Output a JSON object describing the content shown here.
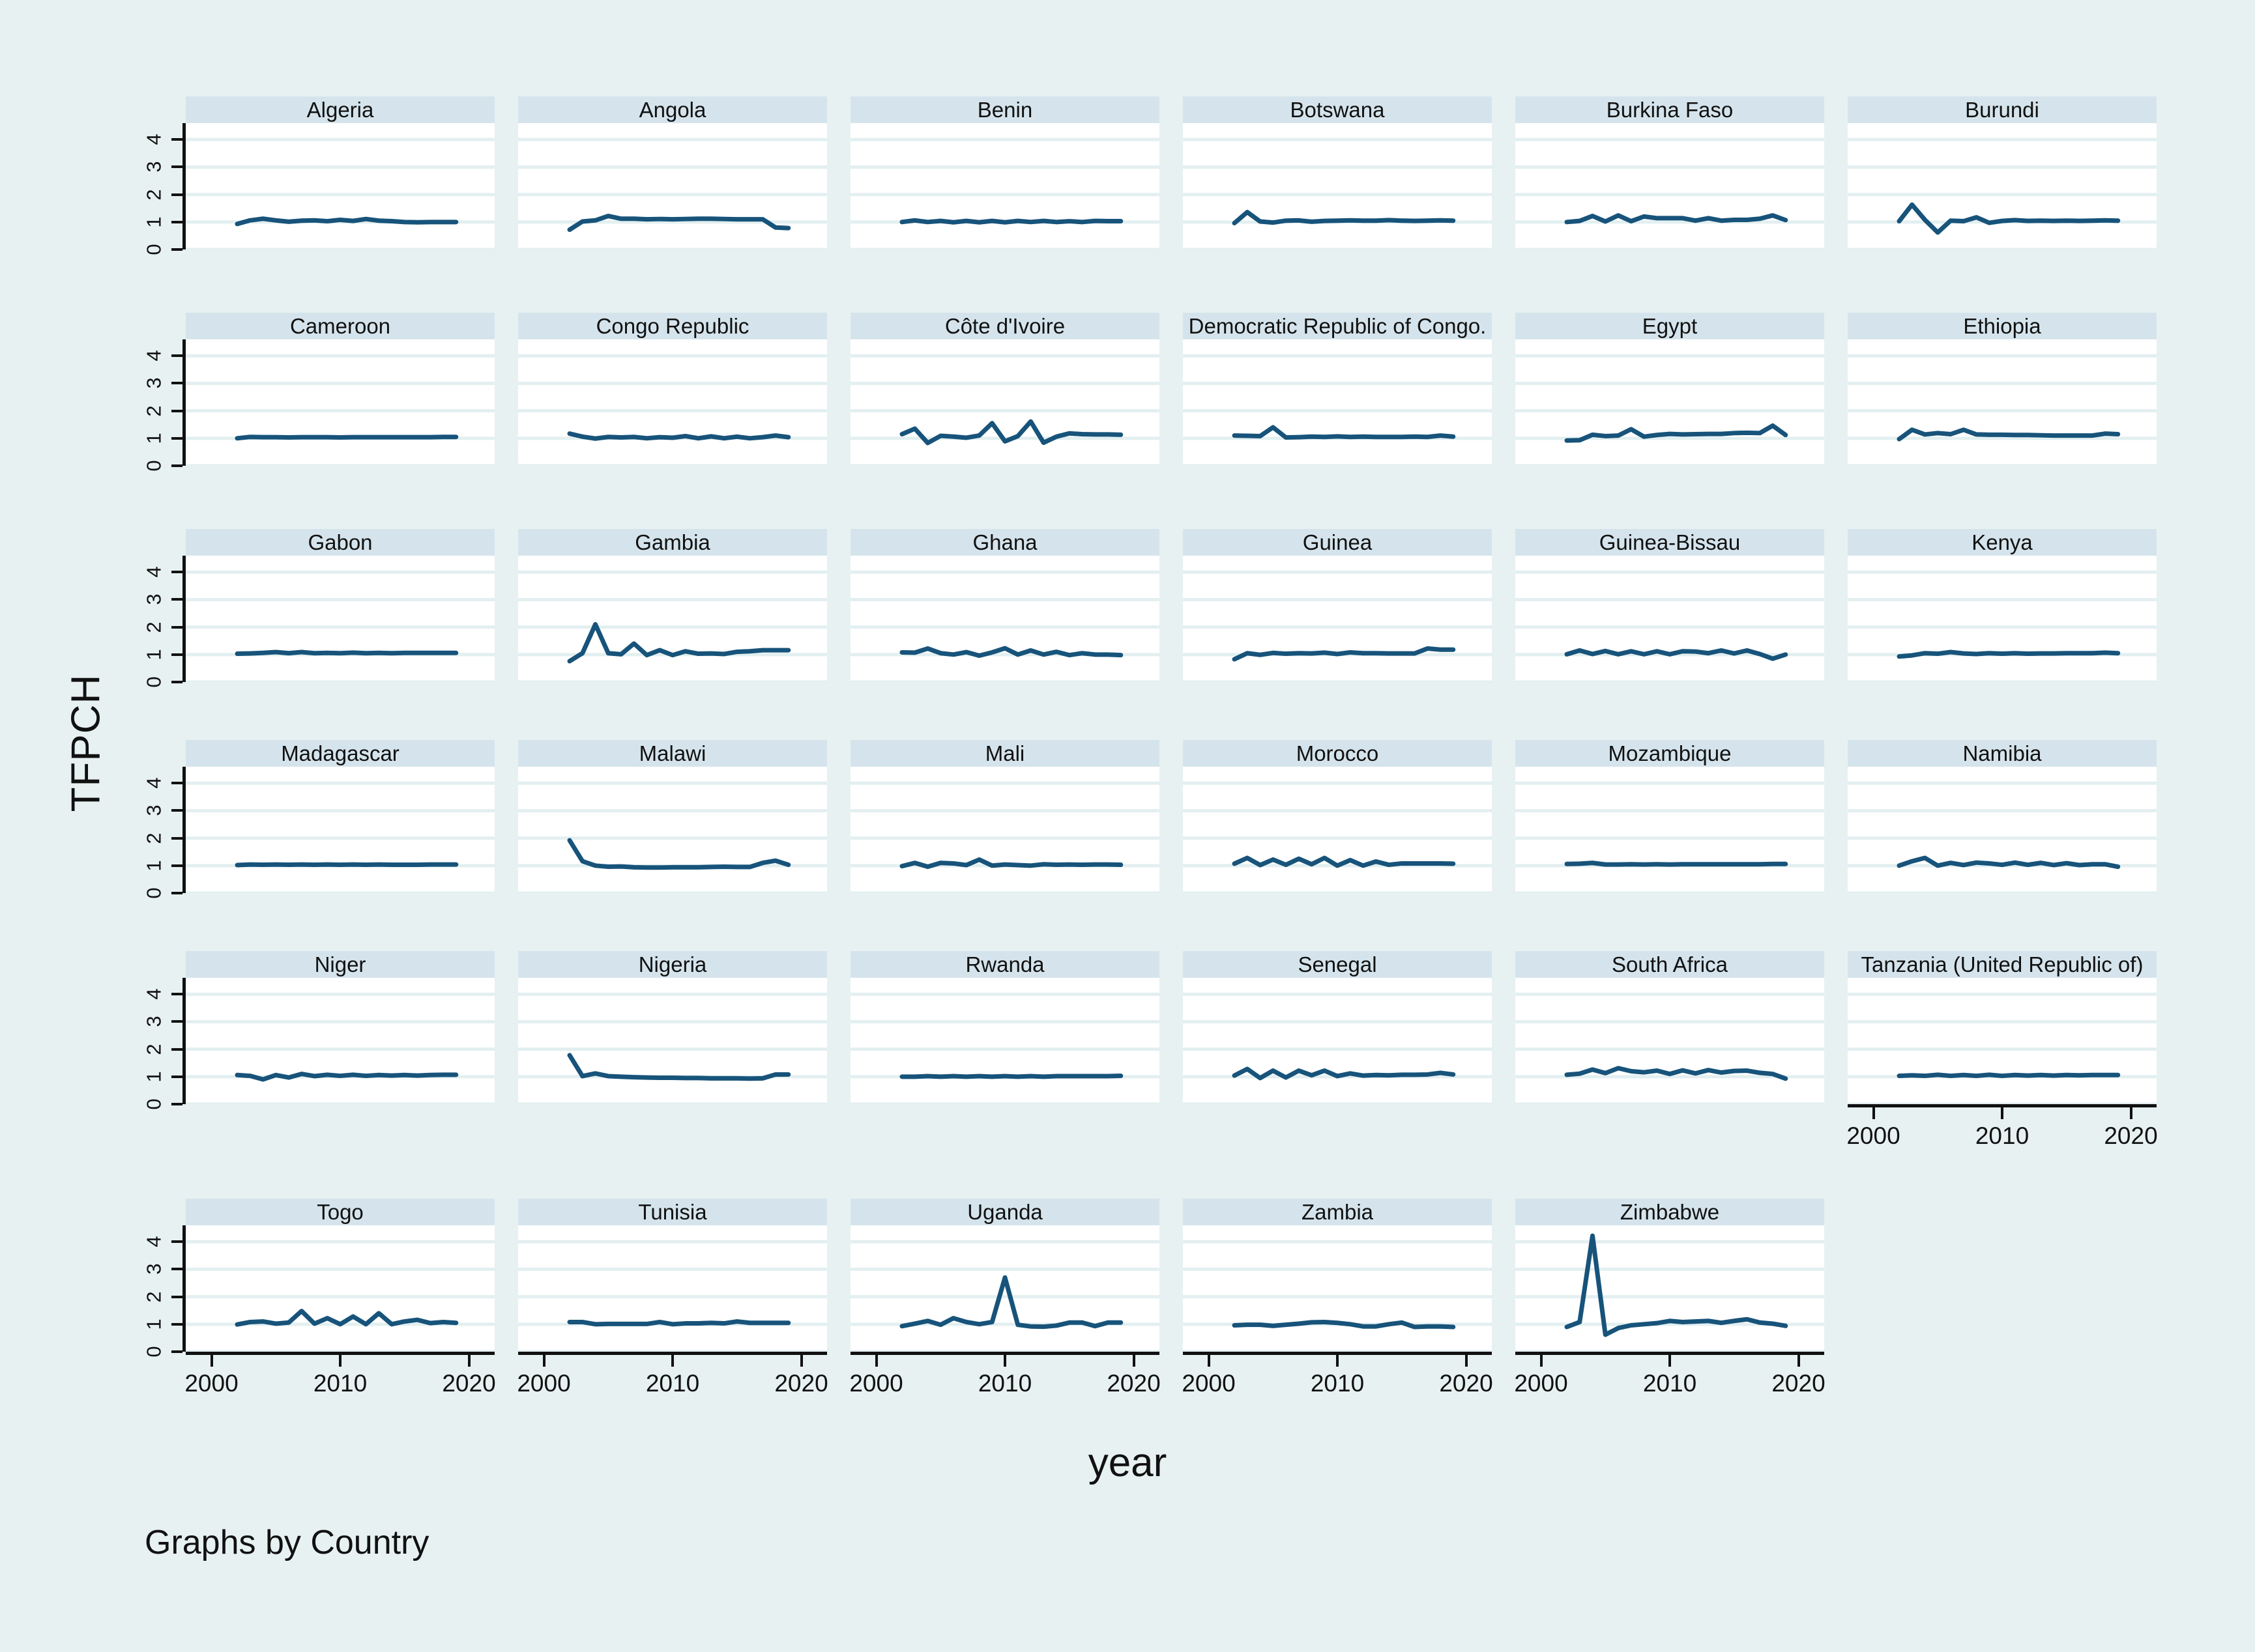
{
  "figure": {
    "background_color": "#e7f1f1",
    "panel_header_color": "#d5e4ec",
    "plot_background_color": "#ffffff",
    "line_color": "#17537a",
    "gridline_color": "#e3eff0",
    "axis_color": "#111111"
  },
  "titles": {
    "ylabel": "TFPCH",
    "xlabel": "year",
    "footer": "Graphs by Country"
  },
  "axes": {
    "y_ticks": [
      "0",
      "1",
      "2",
      "3",
      "4"
    ],
    "y_tick_values": [
      0,
      1,
      2,
      3,
      4
    ],
    "x_ticks": [
      "2000",
      "2010",
      "2020"
    ],
    "x_tick_values": [
      2000,
      2010,
      2020
    ],
    "ylim": [
      0,
      4.6
    ],
    "xlim": [
      1998,
      2022
    ]
  },
  "chart_data": {
    "type": "line",
    "title": "",
    "subtitle": "",
    "xlabel": "year",
    "ylabel": "TFPCH",
    "footer": "Graphs by Country",
    "grid": true,
    "legend": "none",
    "layout": {
      "rows": 6,
      "cols": 6,
      "panels": 33
    },
    "xlim": [
      1998,
      2022
    ],
    "ylim": [
      0,
      4.6
    ],
    "x_ticks": [
      2000,
      2010,
      2020
    ],
    "y_ticks": [
      0,
      1,
      2,
      3,
      4
    ],
    "x": [
      2002,
      2003,
      2004,
      2005,
      2006,
      2007,
      2008,
      2009,
      2010,
      2011,
      2012,
      2013,
      2014,
      2015,
      2016,
      2017,
      2018,
      2019
    ],
    "series": [
      {
        "name": "Algeria",
        "values": [
          0.93,
          1.06,
          1.12,
          1.06,
          1.01,
          1.05,
          1.06,
          1.03,
          1.08,
          1.04,
          1.11,
          1.05,
          1.03,
          1.0,
          0.99,
          1.0,
          1.0,
          1.0
        ]
      },
      {
        "name": "Angola",
        "values": [
          0.72,
          1.02,
          1.06,
          1.22,
          1.12,
          1.12,
          1.1,
          1.11,
          1.1,
          1.11,
          1.12,
          1.12,
          1.11,
          1.1,
          1.1,
          1.1,
          0.8,
          0.78
        ]
      },
      {
        "name": "Benin",
        "values": [
          1.0,
          1.06,
          1.0,
          1.04,
          0.99,
          1.04,
          0.99,
          1.04,
          0.99,
          1.04,
          1.0,
          1.04,
          1.0,
          1.03,
          1.0,
          1.04,
          1.03,
          1.03
        ]
      },
      {
        "name": "Botswana",
        "values": [
          0.96,
          1.36,
          1.02,
          0.98,
          1.05,
          1.06,
          1.01,
          1.04,
          1.05,
          1.06,
          1.05,
          1.05,
          1.07,
          1.05,
          1.04,
          1.05,
          1.06,
          1.05
        ]
      },
      {
        "name": "Burkina Faso",
        "values": [
          1.0,
          1.04,
          1.22,
          1.02,
          1.24,
          1.03,
          1.2,
          1.14,
          1.14,
          1.14,
          1.05,
          1.14,
          1.05,
          1.08,
          1.08,
          1.12,
          1.24,
          1.07
        ]
      },
      {
        "name": "Burundi",
        "values": [
          1.03,
          1.63,
          1.08,
          0.62,
          1.05,
          1.03,
          1.17,
          0.97,
          1.04,
          1.07,
          1.04,
          1.05,
          1.04,
          1.05,
          1.04,
          1.05,
          1.06,
          1.05
        ]
      },
      {
        "name": "Cameroon",
        "values": [
          1.0,
          1.05,
          1.04,
          1.04,
          1.03,
          1.04,
          1.04,
          1.04,
          1.03,
          1.04,
          1.04,
          1.04,
          1.04,
          1.04,
          1.04,
          1.04,
          1.05,
          1.05
        ]
      },
      {
        "name": "Congo Republic",
        "values": [
          1.17,
          1.06,
          0.99,
          1.05,
          1.03,
          1.05,
          1.0,
          1.04,
          1.02,
          1.08,
          1.0,
          1.07,
          1.0,
          1.06,
          1.0,
          1.04,
          1.1,
          1.04
        ]
      },
      {
        "name": "Côte d'Ivoire",
        "values": [
          1.15,
          1.35,
          0.83,
          1.09,
          1.06,
          1.02,
          1.1,
          1.55,
          0.89,
          1.08,
          1.61,
          0.84,
          1.06,
          1.18,
          1.15,
          1.14,
          1.14,
          1.13
        ]
      },
      {
        "name": "Democratic Republic of Congo.",
        "values": [
          1.1,
          1.09,
          1.08,
          1.4,
          1.03,
          1.04,
          1.06,
          1.05,
          1.07,
          1.05,
          1.06,
          1.05,
          1.05,
          1.05,
          1.06,
          1.05,
          1.1,
          1.06
        ]
      },
      {
        "name": "Egypt",
        "values": [
          0.92,
          0.93,
          1.13,
          1.08,
          1.1,
          1.33,
          1.06,
          1.12,
          1.16,
          1.14,
          1.15,
          1.16,
          1.16,
          1.19,
          1.2,
          1.19,
          1.46,
          1.12
        ]
      },
      {
        "name": "Ethiopia",
        "values": [
          0.97,
          1.31,
          1.14,
          1.19,
          1.15,
          1.31,
          1.14,
          1.13,
          1.13,
          1.12,
          1.12,
          1.11,
          1.1,
          1.1,
          1.1,
          1.1,
          1.17,
          1.15
        ]
      },
      {
        "name": "Gabon",
        "values": [
          1.03,
          1.04,
          1.06,
          1.09,
          1.05,
          1.09,
          1.05,
          1.06,
          1.05,
          1.07,
          1.05,
          1.06,
          1.05,
          1.06,
          1.06,
          1.06,
          1.06,
          1.06
        ]
      },
      {
        "name": "Gambia",
        "values": [
          0.76,
          1.05,
          2.1,
          1.05,
          1.01,
          1.4,
          0.98,
          1.16,
          0.98,
          1.12,
          1.03,
          1.04,
          1.02,
          1.1,
          1.12,
          1.16,
          1.16,
          1.16
        ]
      },
      {
        "name": "Ghana",
        "values": [
          1.08,
          1.07,
          1.22,
          1.05,
          1.0,
          1.09,
          0.96,
          1.08,
          1.23,
          1.0,
          1.15,
          1.0,
          1.1,
          0.98,
          1.05,
          1.0,
          1.0,
          0.98
        ]
      },
      {
        "name": "Guinea",
        "values": [
          0.83,
          1.05,
          0.99,
          1.06,
          1.03,
          1.05,
          1.04,
          1.07,
          1.02,
          1.08,
          1.05,
          1.05,
          1.04,
          1.04,
          1.04,
          1.22,
          1.18,
          1.18
        ]
      },
      {
        "name": "Guinea-Bissau",
        "values": [
          1.01,
          1.15,
          1.02,
          1.13,
          1.01,
          1.12,
          1.01,
          1.12,
          1.01,
          1.12,
          1.11,
          1.05,
          1.15,
          1.04,
          1.15,
          1.02,
          0.85,
          1.0
        ]
      },
      {
        "name": "Kenya",
        "values": [
          0.93,
          0.97,
          1.05,
          1.03,
          1.09,
          1.04,
          1.02,
          1.05,
          1.03,
          1.05,
          1.03,
          1.04,
          1.04,
          1.05,
          1.05,
          1.05,
          1.07,
          1.05
        ]
      },
      {
        "name": "Madagascar",
        "values": [
          1.02,
          1.04,
          1.03,
          1.04,
          1.03,
          1.04,
          1.03,
          1.04,
          1.03,
          1.04,
          1.03,
          1.04,
          1.03,
          1.03,
          1.03,
          1.04,
          1.04,
          1.04
        ]
      },
      {
        "name": "Malawi",
        "values": [
          1.92,
          1.16,
          1.0,
          0.96,
          0.97,
          0.94,
          0.93,
          0.93,
          0.94,
          0.94,
          0.94,
          0.95,
          0.96,
          0.95,
          0.95,
          1.1,
          1.18,
          1.03
        ]
      },
      {
        "name": "Mali",
        "values": [
          0.98,
          1.1,
          0.96,
          1.1,
          1.08,
          1.02,
          1.22,
          1.0,
          1.04,
          1.02,
          1.0,
          1.05,
          1.03,
          1.04,
          1.03,
          1.04,
          1.04,
          1.03
        ]
      },
      {
        "name": "Morocco",
        "values": [
          1.07,
          1.28,
          1.02,
          1.22,
          1.03,
          1.25,
          1.05,
          1.28,
          1.0,
          1.2,
          1.0,
          1.15,
          1.03,
          1.08,
          1.08,
          1.08,
          1.08,
          1.07
        ]
      },
      {
        "name": "Mozambique",
        "values": [
          1.06,
          1.07,
          1.1,
          1.04,
          1.04,
          1.05,
          1.04,
          1.05,
          1.04,
          1.05,
          1.05,
          1.05,
          1.05,
          1.05,
          1.05,
          1.05,
          1.06,
          1.06
        ]
      },
      {
        "name": "Namibia",
        "values": [
          1.0,
          1.16,
          1.28,
          1.0,
          1.1,
          1.02,
          1.11,
          1.08,
          1.03,
          1.11,
          1.03,
          1.1,
          1.02,
          1.09,
          1.02,
          1.05,
          1.05,
          0.96
        ]
      },
      {
        "name": "Niger",
        "values": [
          1.06,
          1.03,
          0.9,
          1.06,
          0.97,
          1.1,
          1.02,
          1.07,
          1.03,
          1.07,
          1.03,
          1.06,
          1.04,
          1.06,
          1.04,
          1.06,
          1.07,
          1.07
        ]
      },
      {
        "name": "Nigeria",
        "values": [
          1.78,
          1.02,
          1.12,
          1.02,
          1.0,
          0.98,
          0.97,
          0.96,
          0.96,
          0.95,
          0.95,
          0.94,
          0.94,
          0.94,
          0.93,
          0.94,
          1.08,
          1.08
        ]
      },
      {
        "name": "Rwanda",
        "values": [
          1.0,
          1.0,
          1.02,
          1.0,
          1.02,
          1.0,
          1.02,
          1.0,
          1.02,
          1.0,
          1.02,
          1.0,
          1.02,
          1.02,
          1.02,
          1.02,
          1.02,
          1.03
        ]
      },
      {
        "name": "Senegal",
        "values": [
          1.04,
          1.28,
          0.95,
          1.22,
          0.97,
          1.22,
          1.05,
          1.22,
          1.02,
          1.12,
          1.04,
          1.06,
          1.05,
          1.07,
          1.07,
          1.08,
          1.14,
          1.08
        ]
      },
      {
        "name": "South Africa",
        "values": [
          1.07,
          1.11,
          1.26,
          1.13,
          1.31,
          1.2,
          1.16,
          1.22,
          1.1,
          1.23,
          1.12,
          1.24,
          1.15,
          1.21,
          1.22,
          1.14,
          1.1,
          0.93
        ]
      },
      {
        "name": "Tanzania (United Republic of)",
        "values": [
          1.03,
          1.05,
          1.03,
          1.07,
          1.03,
          1.06,
          1.03,
          1.07,
          1.03,
          1.06,
          1.04,
          1.06,
          1.04,
          1.06,
          1.05,
          1.06,
          1.06,
          1.06
        ]
      },
      {
        "name": "Togo",
        "values": [
          0.99,
          1.08,
          1.1,
          1.02,
          1.06,
          1.48,
          1.02,
          1.22,
          1.0,
          1.28,
          1.0,
          1.4,
          1.0,
          1.1,
          1.16,
          1.04,
          1.08,
          1.05
        ]
      },
      {
        "name": "Tunisia",
        "values": [
          1.08,
          1.08,
          1.0,
          1.01,
          1.01,
          1.01,
          1.01,
          1.08,
          1.0,
          1.03,
          1.03,
          1.05,
          1.03,
          1.1,
          1.05,
          1.05,
          1.05,
          1.05
        ]
      },
      {
        "name": "Uganda",
        "values": [
          0.93,
          1.02,
          1.12,
          0.98,
          1.22,
          1.08,
          1.0,
          1.08,
          2.7,
          0.98,
          0.92,
          0.91,
          0.95,
          1.06,
          1.06,
          0.93,
          1.06,
          1.06
        ]
      },
      {
        "name": "Zambia",
        "values": [
          0.96,
          0.98,
          0.98,
          0.94,
          0.98,
          1.02,
          1.07,
          1.08,
          1.05,
          1.0,
          0.92,
          0.92,
          1.0,
          1.06,
          0.9,
          0.92,
          0.92,
          0.9
        ]
      },
      {
        "name": "Zimbabwe",
        "values": [
          0.9,
          1.08,
          4.22,
          0.62,
          0.86,
          0.96,
          1.0,
          1.04,
          1.12,
          1.08,
          1.1,
          1.12,
          1.05,
          1.12,
          1.18,
          1.06,
          1.02,
          0.94
        ]
      }
    ]
  },
  "panels": [
    {
      "row": 0,
      "col": 0,
      "title": "Algeria",
      "series": "Algeria"
    },
    {
      "row": 0,
      "col": 1,
      "title": "Angola",
      "series": "Angola"
    },
    {
      "row": 0,
      "col": 2,
      "title": "Benin",
      "series": "Benin"
    },
    {
      "row": 0,
      "col": 3,
      "title": "Botswana",
      "series": "Botswana"
    },
    {
      "row": 0,
      "col": 4,
      "title": "Burkina Faso",
      "series": "Burkina Faso"
    },
    {
      "row": 0,
      "col": 5,
      "title": "Burundi",
      "series": "Burundi"
    },
    {
      "row": 1,
      "col": 0,
      "title": "Cameroon",
      "series": "Cameroon"
    },
    {
      "row": 1,
      "col": 1,
      "title": "Congo Republic",
      "series": "Congo Republic"
    },
    {
      "row": 1,
      "col": 2,
      "title": "Côte d'Ivoire",
      "series": "Côte d'Ivoire"
    },
    {
      "row": 1,
      "col": 3,
      "title": "Democratic Republic of Congo.",
      "series": "Democratic Republic of Congo.",
      "overflow": true
    },
    {
      "row": 1,
      "col": 4,
      "title": "Egypt",
      "series": "Egypt"
    },
    {
      "row": 1,
      "col": 5,
      "title": "Ethiopia",
      "series": "Ethiopia"
    },
    {
      "row": 2,
      "col": 0,
      "title": "Gabon",
      "series": "Gabon"
    },
    {
      "row": 2,
      "col": 1,
      "title": "Gambia",
      "series": "Gambia"
    },
    {
      "row": 2,
      "col": 2,
      "title": "Ghana",
      "series": "Ghana"
    },
    {
      "row": 2,
      "col": 3,
      "title": "Guinea",
      "series": "Guinea"
    },
    {
      "row": 2,
      "col": 4,
      "title": "Guinea-Bissau",
      "series": "Guinea-Bissau"
    },
    {
      "row": 2,
      "col": 5,
      "title": "Kenya",
      "series": "Kenya"
    },
    {
      "row": 3,
      "col": 0,
      "title": "Madagascar",
      "series": "Madagascar"
    },
    {
      "row": 3,
      "col": 1,
      "title": "Malawi",
      "series": "Malawi"
    },
    {
      "row": 3,
      "col": 2,
      "title": "Mali",
      "series": "Mali"
    },
    {
      "row": 3,
      "col": 3,
      "title": "Morocco",
      "series": "Morocco"
    },
    {
      "row": 3,
      "col": 4,
      "title": "Mozambique",
      "series": "Mozambique"
    },
    {
      "row": 3,
      "col": 5,
      "title": "Namibia",
      "series": "Namibia"
    },
    {
      "row": 4,
      "col": 0,
      "title": "Niger",
      "series": "Niger"
    },
    {
      "row": 4,
      "col": 1,
      "title": "Nigeria",
      "series": "Nigeria"
    },
    {
      "row": 4,
      "col": 2,
      "title": "Rwanda",
      "series": "Rwanda"
    },
    {
      "row": 4,
      "col": 3,
      "title": "Senegal",
      "series": "Senegal"
    },
    {
      "row": 4,
      "col": 4,
      "title": "South Africa",
      "series": "South Africa"
    },
    {
      "row": 4,
      "col": 5,
      "title": "Tanzania (United Republic of)",
      "series": "Tanzania (United Republic of)",
      "overflow": true,
      "xaxis": true
    },
    {
      "row": 5,
      "col": 0,
      "title": "Togo",
      "series": "Togo",
      "xaxis": true
    },
    {
      "row": 5,
      "col": 1,
      "title": "Tunisia",
      "series": "Tunisia",
      "xaxis": true
    },
    {
      "row": 5,
      "col": 2,
      "title": "Uganda",
      "series": "Uganda",
      "xaxis": true
    },
    {
      "row": 5,
      "col": 3,
      "title": "Zambia",
      "series": "Zambia",
      "xaxis": true
    },
    {
      "row": 5,
      "col": 4,
      "title": "Zimbabwe",
      "series": "Zimbabwe",
      "xaxis": true
    }
  ]
}
